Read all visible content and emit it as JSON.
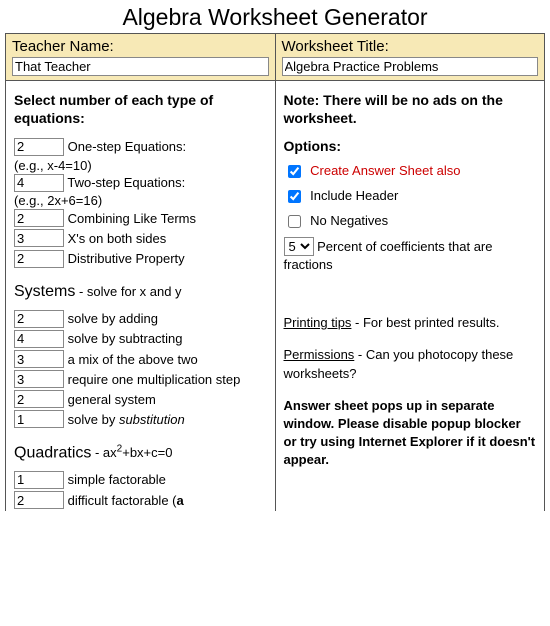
{
  "title": "Algebra Worksheet Generator",
  "left_header": {
    "label": "Teacher Name:",
    "value": "That Teacher"
  },
  "right_header": {
    "label": "Worksheet Title:",
    "value": "Algebra Practice Problems"
  },
  "left": {
    "heading": "Select number of each type of equations:",
    "eq1": {
      "count": "2",
      "label": "One-step Equations:",
      "example": "(e.g., x-4=10)"
    },
    "eq2": {
      "count": "4",
      "label": "Two-step Equations:",
      "example": "(e.g., 2x+6=16)"
    },
    "eq3": {
      "count": "2",
      "label": "Combining Like Terms"
    },
    "eq4": {
      "count": "3",
      "label": "X's on both sides"
    },
    "eq5": {
      "count": "2",
      "label": "Distributive Property"
    },
    "systems": {
      "title": "Systems",
      "explain": " - solve for x and y"
    },
    "sys1": {
      "count": "2",
      "label": "solve by adding"
    },
    "sys2": {
      "count": "4",
      "label": "solve by subtracting"
    },
    "sys3": {
      "count": "3",
      "label": "a mix of the above two"
    },
    "sys4": {
      "count": "3",
      "label": "require one multiplication step"
    },
    "sys5": {
      "count": "2",
      "label": "general system"
    },
    "sys6": {
      "count": "1",
      "label_pre": "solve by ",
      "label_ital": "substitution"
    },
    "quad": {
      "title": "Quadratics",
      "explain_pre": " - ax",
      "explain_post": "+bx+c=0"
    },
    "q1": {
      "count": "1",
      "label": "simple factorable"
    },
    "q2": {
      "count": "2",
      "label_pre": "difficult factorable (",
      "label_bold": "a"
    }
  },
  "right": {
    "note": "Note: There will be no ads on the worksheet.",
    "options_label": "Options:",
    "opt1": {
      "checked": true,
      "label": "Create Answer Sheet also"
    },
    "opt2": {
      "checked": true,
      "label": "Include Header"
    },
    "opt3": {
      "checked": false,
      "label": "No Negatives"
    },
    "percent": {
      "value": "5",
      "label": "Percent of coefficients that are fractions"
    },
    "tips": {
      "link": "Printing tips",
      "rest": " - For best printed results."
    },
    "perms": {
      "link": "Permissions",
      "rest": " - Can you photocopy these worksheets?"
    },
    "popup": "Answer sheet pops up in separate window. Please disable popup blocker or try using Internet Explorer if it doesn't appear."
  }
}
